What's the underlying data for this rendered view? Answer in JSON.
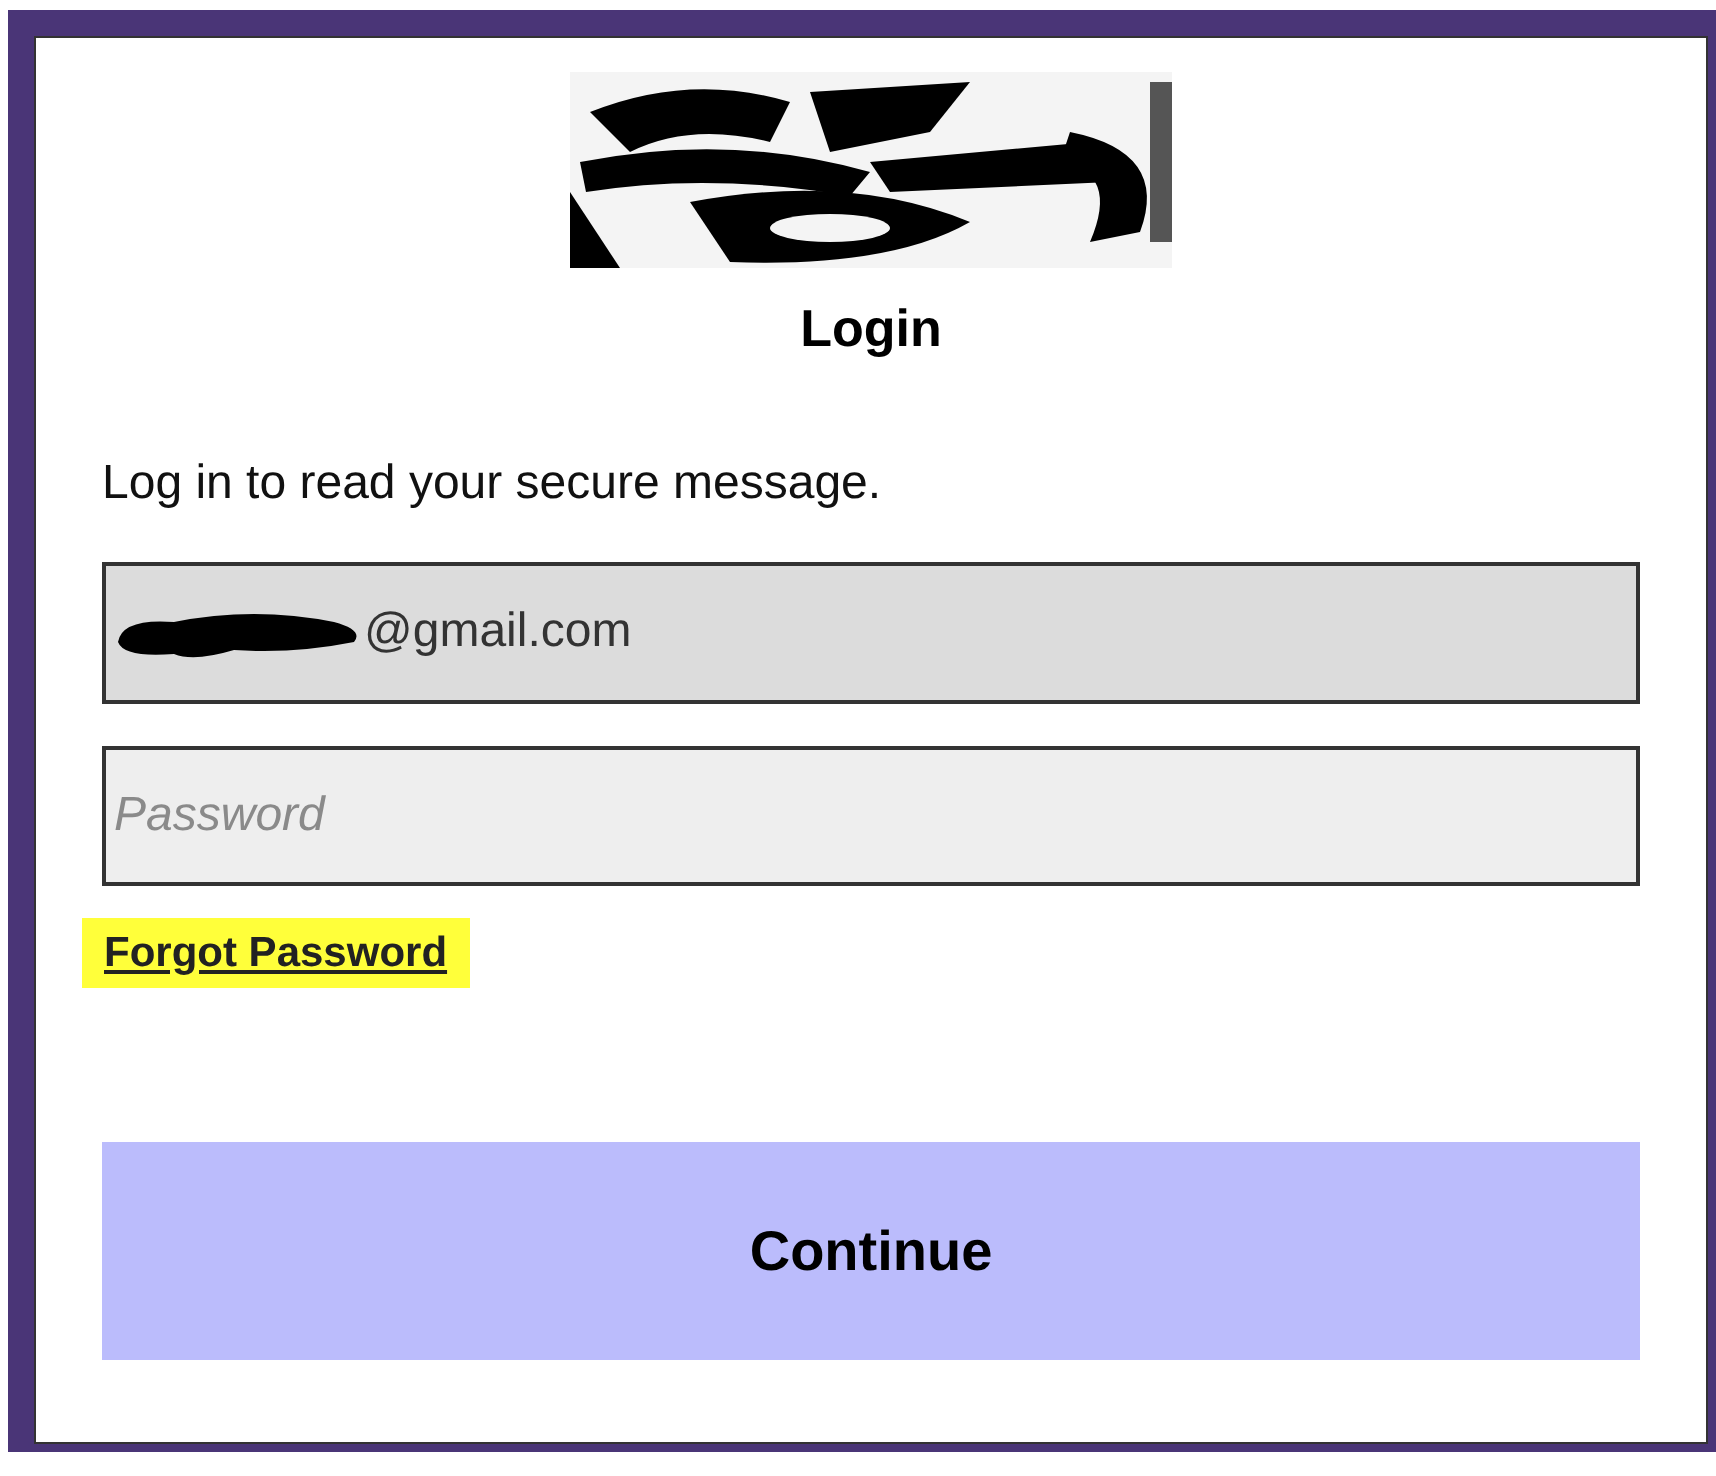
{
  "title": "Login",
  "intro": "Log in to read your secure message.",
  "email_field": {
    "value": "@gmail.com",
    "redacted_prefix": true
  },
  "password_field": {
    "placeholder": "Password"
  },
  "forgot_link": {
    "label": "Forgot Password",
    "highlighted": true
  },
  "continue_button": {
    "label": "Continue"
  }
}
